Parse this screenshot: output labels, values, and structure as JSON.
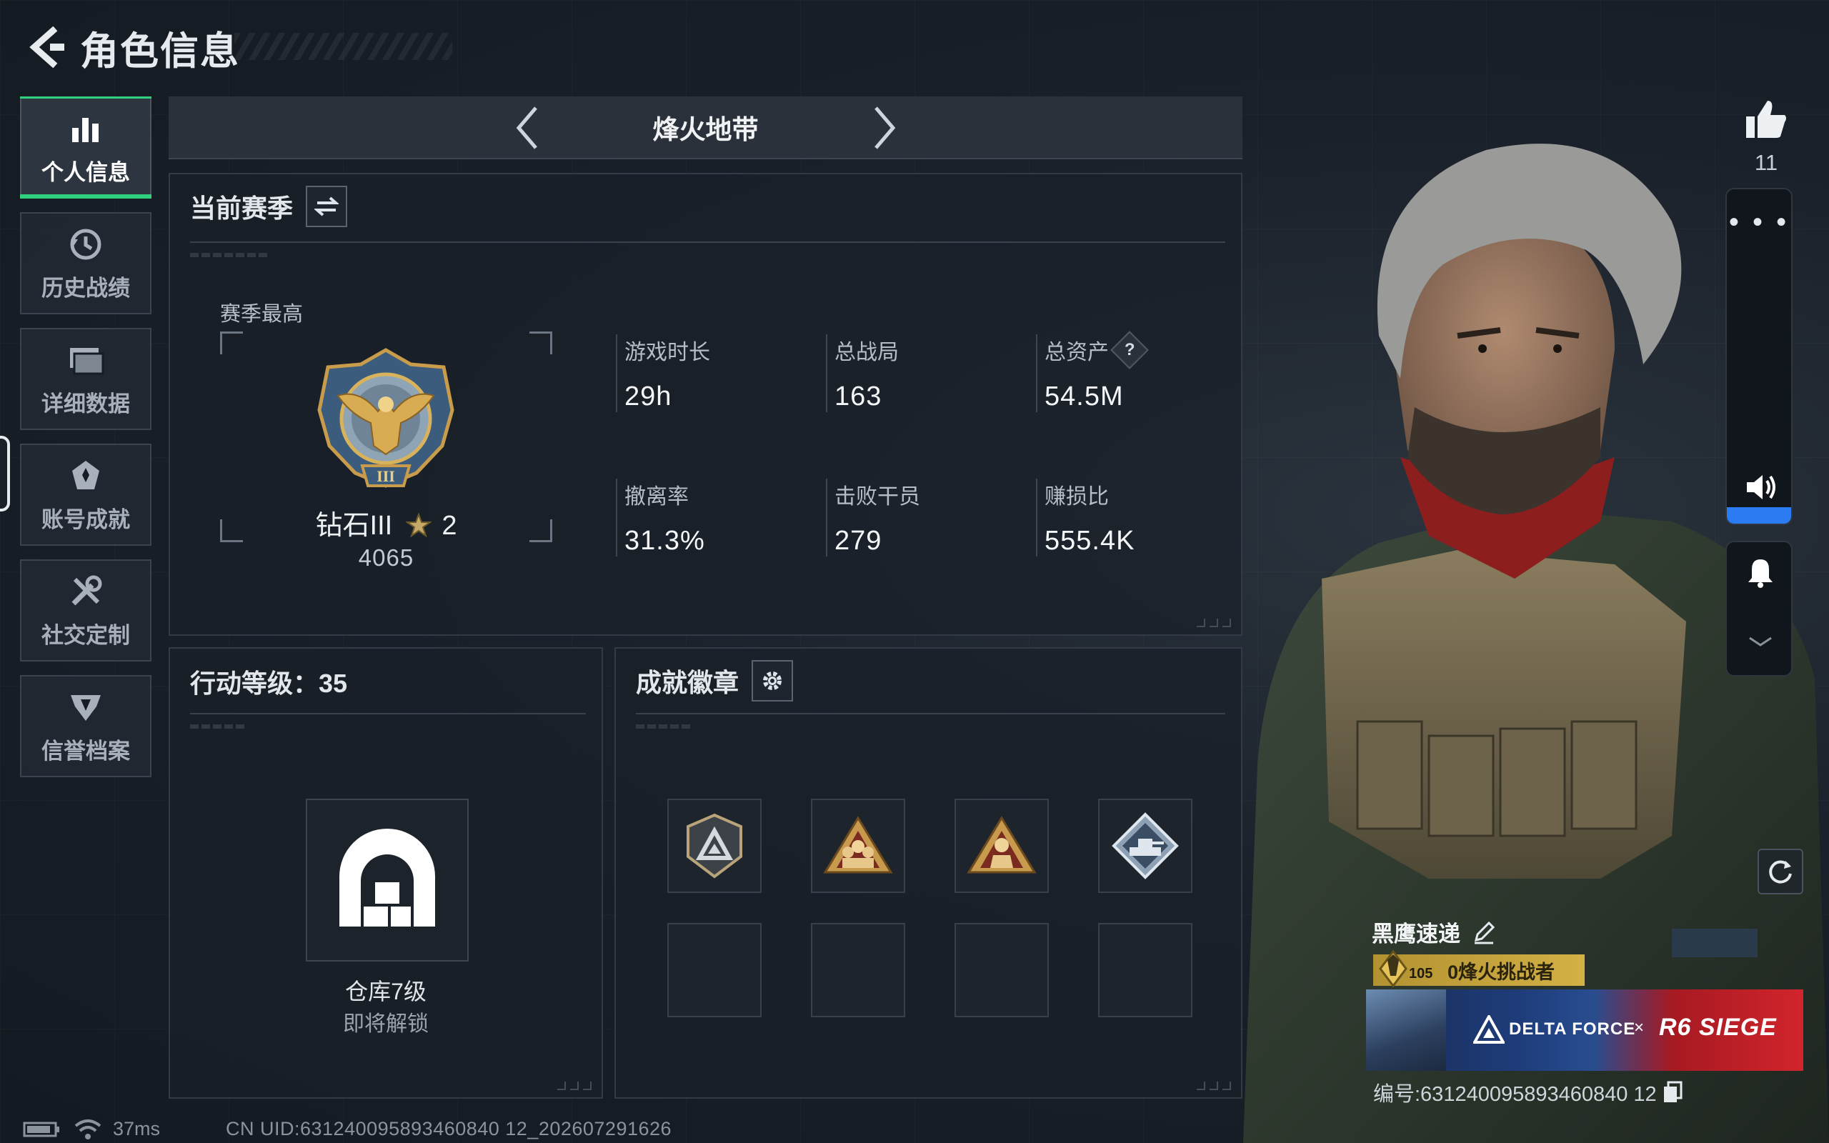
{
  "header": {
    "title": "角色信息"
  },
  "sidebar": {
    "items": [
      {
        "label": "个人信息",
        "icon": "bar-chart-icon",
        "active": true
      },
      {
        "label": "历史战绩",
        "icon": "history-clock-icon",
        "active": false
      },
      {
        "label": "详细数据",
        "icon": "folder-data-icon",
        "active": false
      },
      {
        "label": "账号成就",
        "icon": "achievement-icon",
        "active": false
      },
      {
        "label": "社交定制",
        "icon": "tools-icon",
        "active": false
      },
      {
        "label": "信誉档案",
        "icon": "reputation-shield-icon",
        "active": false
      }
    ]
  },
  "mode": {
    "title": "烽火地带"
  },
  "season": {
    "title": "当前赛季",
    "best_label": "赛季最高",
    "rank_name": "钻石III",
    "rank_stars": "2",
    "rank_score": "4065",
    "stats": [
      {
        "label": "游戏时长",
        "value": "29h"
      },
      {
        "label": "总战局",
        "value": "163"
      },
      {
        "label": "总资产",
        "value": "54.5M",
        "help": "?"
      },
      {
        "label": "撤离率",
        "value": "31.3%"
      },
      {
        "label": "击败干员",
        "value": "279"
      },
      {
        "label": "赚损比",
        "value": "555.4K"
      }
    ]
  },
  "level": {
    "title": "行动等级：35",
    "warehouse_title": "仓库7级",
    "warehouse_sub": "即将解锁"
  },
  "badges": {
    "title": "成就徽章",
    "slots": [
      {
        "icon": "delta-badge-icon",
        "filled": true
      },
      {
        "icon": "squad-badge-icon",
        "filled": true
      },
      {
        "icon": "operator-badge-icon",
        "filled": true
      },
      {
        "icon": "vehicle-badge-icon",
        "filled": true
      },
      {
        "icon": "",
        "filled": false
      },
      {
        "icon": "",
        "filled": false
      },
      {
        "icon": "",
        "filled": false
      },
      {
        "icon": "",
        "filled": false
      }
    ]
  },
  "social": {
    "like_count": "11",
    "more_label": "• • •",
    "volume_level": 0.05
  },
  "player": {
    "name": "黑鹰速递",
    "level_badge": "105",
    "title_tag": "0烽火挑战者",
    "banner_brand": "DELTA FORCE",
    "banner_x": "×",
    "banner_partner": "R6 SIEGE",
    "id_text": "编号:631240095893460840 12"
  },
  "status": {
    "ping": "37ms",
    "uid": "CN UID:631240095893460840 12_202607291626"
  },
  "colors": {
    "accent_green": "#2fd07e",
    "volume_blue": "#2b7bf2",
    "gold": "#c9a741"
  }
}
